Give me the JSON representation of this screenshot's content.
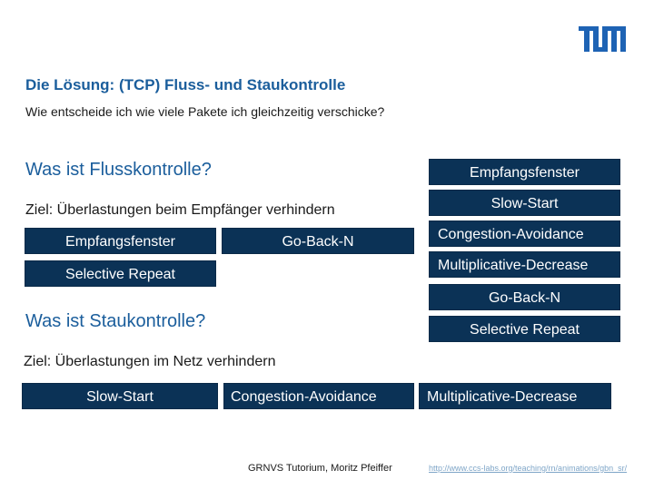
{
  "header": {
    "logo": "tum-logo",
    "logo_color": "#1e63b4",
    "title": "Die Lösung: (TCP) Fluss- und Staukontrolle",
    "subtitle": "Wie entscheide ich wie viele Pakete ich gleichzeitig verschicke?"
  },
  "flow_control": {
    "heading": "Was ist Flusskontrolle?",
    "goal": "Ziel: Überlastungen beim Empfänger verhindern",
    "boxes": [
      "Empfangsfenster",
      "Go-Back-N",
      "Selective Repeat"
    ]
  },
  "congestion_control": {
    "heading": "Was ist Staukontrolle?",
    "goal": "Ziel: Überlastungen im Netz verhindern",
    "boxes": [
      "Slow-Start",
      "Congestion-Avoidance",
      "Multiplicative-Decrease"
    ]
  },
  "pool": {
    "boxes": [
      "Empfangsfenster",
      "Slow-Start",
      "Congestion-Avoidance",
      "Multiplicative-Decrease",
      "Go-Back-N",
      "Selective Repeat"
    ]
  },
  "footer": {
    "author": "GRNVS Tutorium, Moritz Pfeiffer",
    "link": "http://www.ccs-labs.org/teaching/rn/animations/gbn_sr/"
  },
  "colors": {
    "accent": "#1b5e9c",
    "box_bg": "#0b3256",
    "box_text": "#ffffff"
  }
}
